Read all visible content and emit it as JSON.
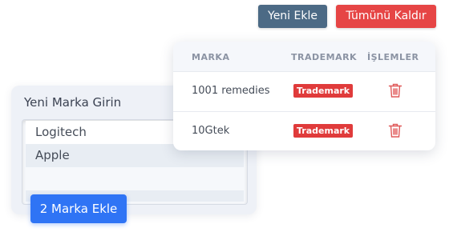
{
  "header_buttons": {
    "add_new": "Yeni Ekle",
    "remove_all": "Tümünü Kaldır"
  },
  "entry_panel": {
    "title": "Yeni Marka Girin",
    "items": [
      "Logitech",
      "Apple"
    ],
    "add_button": "2 Marka Ekle"
  },
  "brand_table": {
    "columns": [
      "MARKA",
      "TRADEMARK",
      "İŞLEMLER"
    ],
    "rows": [
      {
        "brand": "1001 remedies",
        "trademark": "Trademark",
        "action_icon": "trash-icon"
      },
      {
        "brand": "10Gtek",
        "trademark": "Trademark",
        "action_icon": "trash-icon"
      }
    ]
  },
  "colors": {
    "primary_blue": "#2f74f5",
    "slate_button": "#4c6a85",
    "danger_red": "#e64545",
    "badge_red": "#e03b3b"
  }
}
